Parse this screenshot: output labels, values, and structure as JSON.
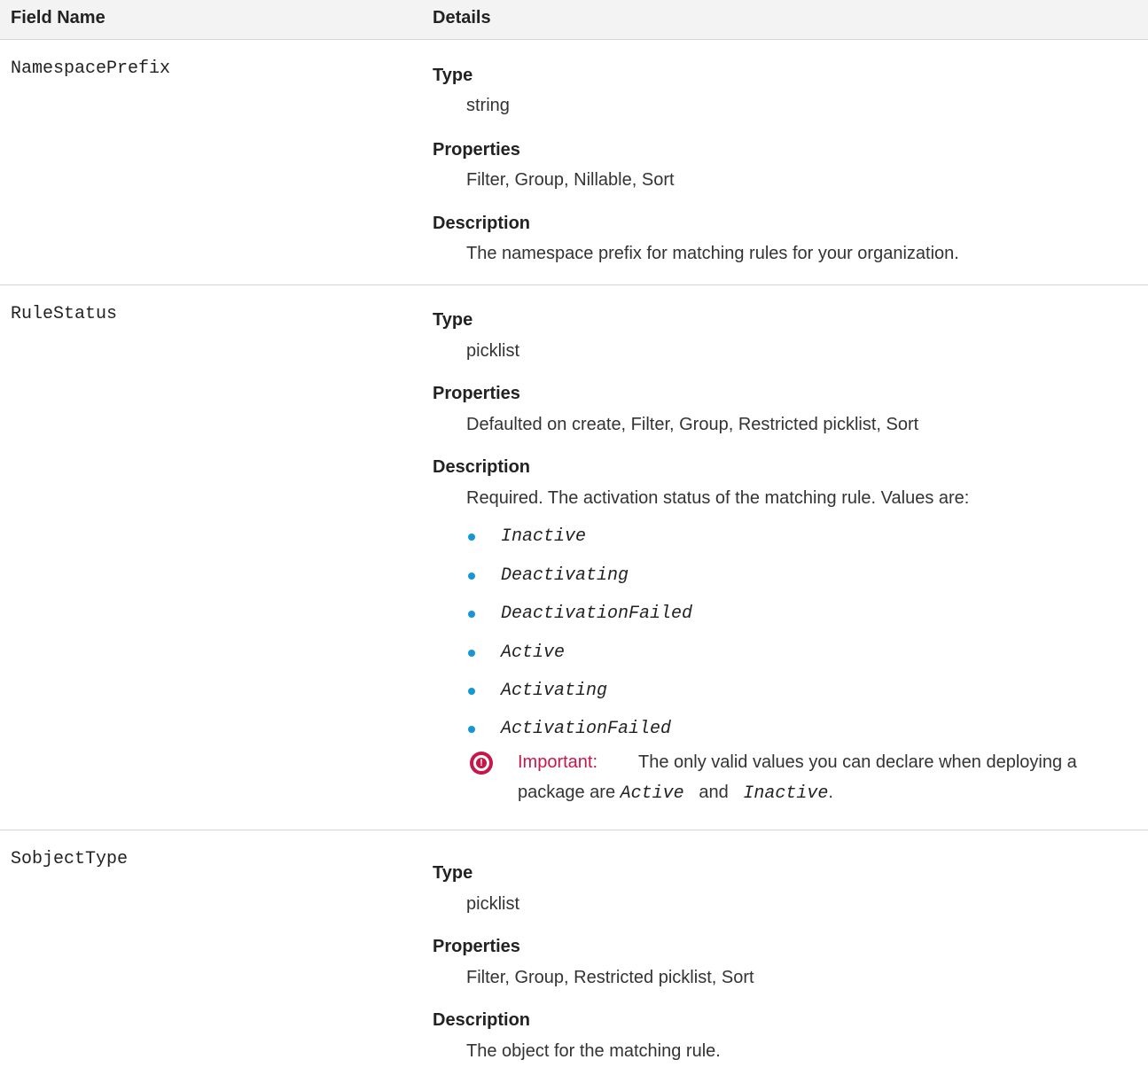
{
  "header": {
    "field_name": "Field Name",
    "details": "Details"
  },
  "rows": [
    {
      "field": "NamespacePrefix",
      "type_label": "Type",
      "type": "string",
      "properties_label": "Properties",
      "properties": "Filter, Group, Nillable, Sort",
      "description_label": "Description",
      "description": "The namespace prefix for matching rules for your organization."
    },
    {
      "field": "RuleStatus",
      "type_label": "Type",
      "type": "picklist",
      "properties_label": "Properties",
      "properties": "Defaulted on create, Filter, Group, Restricted picklist, Sort",
      "description_label": "Description",
      "description": "Required. The activation status of the matching rule. Values are:",
      "values": [
        "Inactive",
        "Deactivating",
        "DeactivationFailed",
        "Active",
        "Activating",
        "ActivationFailed"
      ],
      "important": {
        "label": "Important:",
        "text_line1": "The only valid values you can declare when deploying a",
        "text_line2_prefix": "package are",
        "code1": "Active",
        "conj": "and",
        "code2": "Inactive",
        "end": "."
      }
    },
    {
      "field": "SobjectType",
      "type_label": "Type",
      "type": "picklist",
      "properties_label": "Properties",
      "properties": "Filter, Group, Restricted picklist, Sort",
      "description_label": "Description",
      "description": "The object for the matching rule."
    }
  ]
}
